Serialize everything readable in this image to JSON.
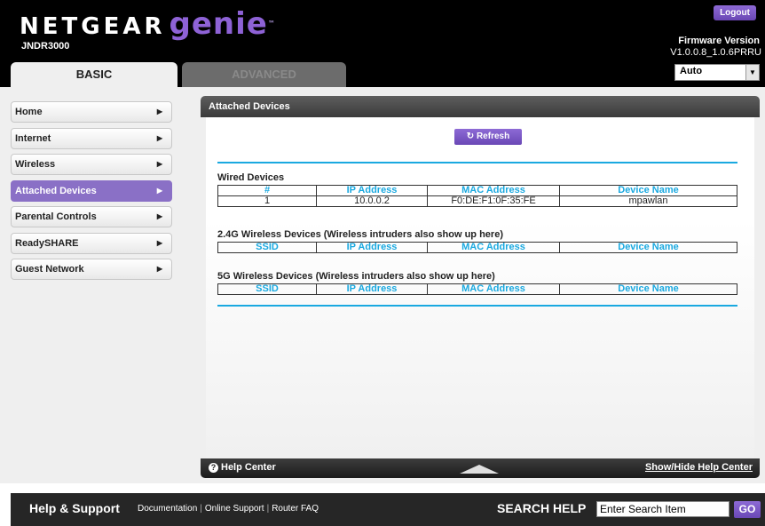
{
  "header": {
    "brand_main": "NETGEAR",
    "brand_sub": "genie",
    "brand_tm": "™",
    "model": "JNDR3000",
    "logout_label": "Logout",
    "firmware_label": "Firmware Version",
    "firmware_value": "V1.0.0.8_1.0.6PRRU",
    "language_value": "Auto"
  },
  "tabs": {
    "basic": "BASIC",
    "advanced": "ADVANCED"
  },
  "sidebar": {
    "items": [
      {
        "label": "Home",
        "active": false
      },
      {
        "label": "Internet",
        "active": false
      },
      {
        "label": "Wireless",
        "active": false
      },
      {
        "label": "Attached Devices",
        "active": true
      },
      {
        "label": "Parental Controls",
        "active": false
      },
      {
        "label": "ReadySHARE",
        "active": false
      },
      {
        "label": "Guest Network",
        "active": false
      }
    ]
  },
  "panel": {
    "title": "Attached Devices",
    "refresh_label": "Refresh",
    "wired": {
      "title": "Wired Devices",
      "columns": [
        "#",
        "IP Address",
        "MAC Address",
        "Device Name"
      ],
      "rows": [
        [
          "1",
          "10.0.0.2",
          "F0:DE:F1:0F:35:FE",
          "mpawlan"
        ]
      ]
    },
    "wireless24": {
      "title": "2.4G Wireless Devices (Wireless intruders also show up here)",
      "columns": [
        "SSID",
        "IP Address",
        "MAC Address",
        "Device Name"
      ]
    },
    "wireless5": {
      "title": "5G Wireless Devices (Wireless intruders also show up here)",
      "columns": [
        "SSID",
        "IP Address",
        "MAC Address",
        "Device Name"
      ]
    },
    "help_center": "Help Center",
    "show_hide_help": "Show/Hide Help Center"
  },
  "footer": {
    "title": "Help & Support",
    "links": [
      "Documentation",
      "Online Support",
      "Router FAQ"
    ],
    "search_label": "SEARCH HELP",
    "search_placeholder": "Enter Search Item",
    "go_label": "GO"
  },
  "colors": {
    "accent_purple": "#8a70c6",
    "table_header_blue": "#1aa9e0"
  }
}
